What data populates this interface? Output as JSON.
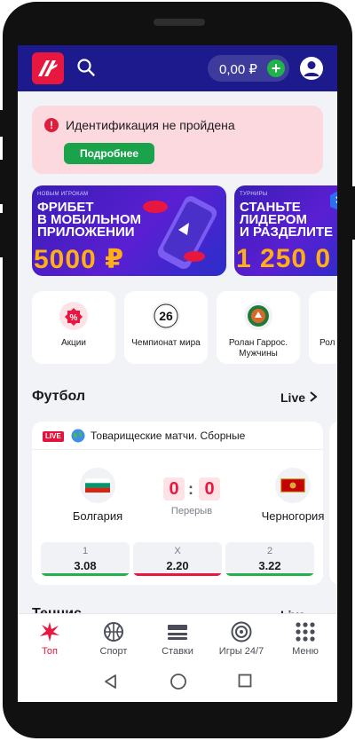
{
  "header": {
    "balance": "0,00 ₽",
    "plus": "+"
  },
  "alert": {
    "text": "Идентификация не пройдена",
    "button": "Подробнее"
  },
  "banners": [
    {
      "tag": "НОВЫМ ИГРОКАМ",
      "title_line1": "ФРИБЕТ",
      "title_line2": "В МОБИЛЬНОМ",
      "title_line3": "ПРИЛОЖЕНИИ",
      "amount": "5000 ₽"
    },
    {
      "tag": "ТУРНИРЫ",
      "title_line1": "СТАНЬТЕ",
      "title_line2": "ЛИДЕРОМ",
      "title_line3": "И РАЗДЕЛИТЕ",
      "amount": "1 250 0"
    }
  ],
  "categories": [
    {
      "label": "Акции",
      "icon": "promo-icon"
    },
    {
      "label": "Чемпионат мира",
      "icon": "world-cup-icon"
    },
    {
      "label": "Ролан Гаррос. Мужчины",
      "icon": "roland-garros-icon"
    },
    {
      "label": "Рол Ж",
      "icon": "roland-garros-icon"
    }
  ],
  "football": {
    "title": "Футбол",
    "live": "Live",
    "match": {
      "live_badge": "LIVE",
      "league": "Товарищеские матчи. Сборные",
      "team1": "Болгария",
      "team2": "Черногория",
      "score1": "0",
      "score2": "0",
      "period": "Перерыв",
      "odds": [
        {
          "label": "1",
          "value": "3.08",
          "color": "#22b24c"
        },
        {
          "label": "X",
          "value": "2.20",
          "color": "#e8173f"
        },
        {
          "label": "2",
          "value": "3.22",
          "color": "#22b24c"
        }
      ]
    }
  },
  "next_section": {
    "title": "Теннис",
    "live": "Live"
  },
  "nav": [
    {
      "label": "Топ",
      "icon": "star-burst-icon",
      "active": true
    },
    {
      "label": "Спорт",
      "icon": "ball-icon",
      "active": false
    },
    {
      "label": "Ставки",
      "icon": "bets-icon",
      "active": false
    },
    {
      "label": "Игры 24/7",
      "icon": "target-icon",
      "active": false
    },
    {
      "label": "Меню",
      "icon": "grid-icon",
      "active": false
    }
  ],
  "colors": {
    "brand_red": "#e8173f",
    "header_blue": "#1c1a8c",
    "green": "#22b24c",
    "banner_amount": "#ffae16"
  }
}
